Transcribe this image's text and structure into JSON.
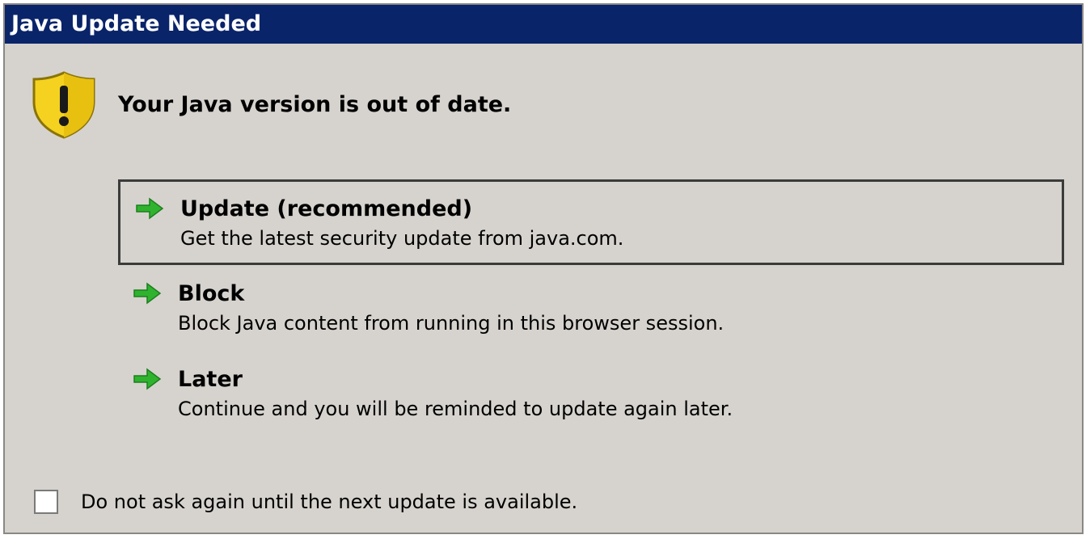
{
  "window": {
    "title": "Java Update Needed"
  },
  "header": {
    "icon": "warning-shield-icon",
    "message": "Your Java version is out of date."
  },
  "options": [
    {
      "icon": "green-arrow-icon",
      "title": "Update (recommended)",
      "description": "Get the latest security update from java.com.",
      "selected": true
    },
    {
      "icon": "green-arrow-icon",
      "title": "Block",
      "description": "Block Java content from running in this browser session.",
      "selected": false
    },
    {
      "icon": "green-arrow-icon",
      "title": "Later",
      "description": "Continue and you will be reminded to update again later.",
      "selected": false
    }
  ],
  "footer": {
    "checkbox_label": "Do not ask again until the next update is available.",
    "checked": false
  },
  "colors": {
    "titlebar": "#0a246a",
    "dialog_background": "#d6d3ce",
    "arrow_green": "#2fb32f",
    "shield_yellow": "#f5d21f"
  }
}
